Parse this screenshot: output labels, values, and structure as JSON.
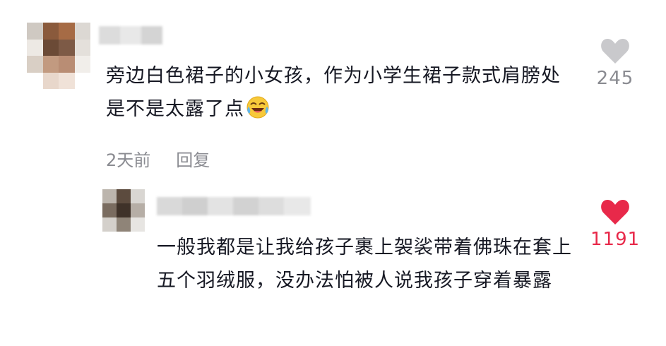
{
  "comment": {
    "text": "旁边白色裙子的小女孩，作为小学生裙子款式肩膀处是不是太露了点",
    "emoji": "laughing-crying-emoji",
    "time": "2天前",
    "reply_label": "回复",
    "likes": "245",
    "liked": false
  },
  "reply": {
    "text": "一般我都是让我给孩子裹上袈裟带着佛珠在套上五个羽绒服，没办法怕被人说我孩子穿着暴露",
    "likes": "1191",
    "liked": true
  },
  "colors": {
    "text": "#161823",
    "muted": "#8a8b91",
    "like_inactive": "#c9c9cc",
    "like_active": "#e8294a"
  }
}
